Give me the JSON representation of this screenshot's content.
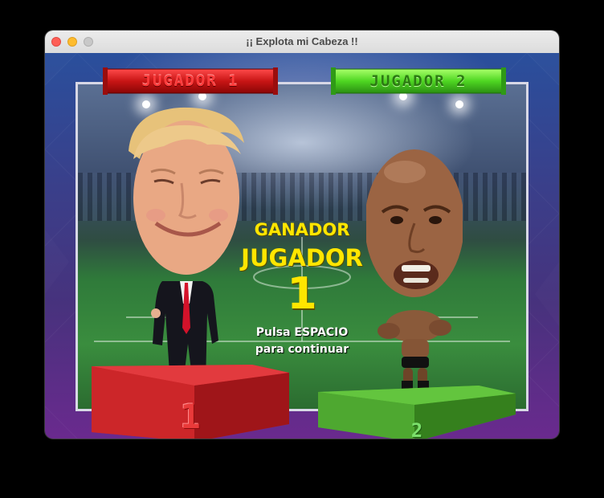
{
  "window": {
    "title": "¡¡ Explota mi Cabeza !!"
  },
  "banners": {
    "player1": "JUGADOR 1",
    "player2": "JUGADOR 2"
  },
  "result": {
    "winner_label": "GANADOR",
    "player_word": "JUGADOR",
    "winner_number": "1",
    "prompt_line1": "Pulsa ESPACIO",
    "prompt_line2": "para continuar"
  },
  "podiums": {
    "player1": "1",
    "player2": "2"
  },
  "colors": {
    "player1": "#d8282d",
    "player2": "#4eab2f",
    "highlight": "#ffe600"
  },
  "icons": {
    "close": "close-dot",
    "minimize": "minimize-dot",
    "maximize": "maximize-dot"
  }
}
